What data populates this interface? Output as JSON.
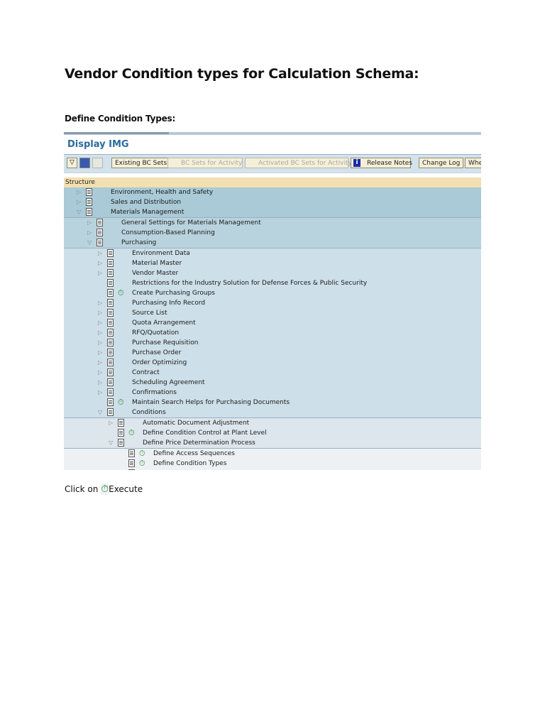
{
  "heading": "Vendor Condition types for Calculation Schema:",
  "subheading": "Define Condition Types:",
  "screen": {
    "title": "Display IMG",
    "toolbar": {
      "existing_bc_sets": "Existing BC Sets",
      "bc_sets_for_activity": "BC Sets for Activity",
      "activated_bc_sets": "Activated BC Sets for Activity",
      "release_notes": "Release Notes",
      "change_log": "Change Log",
      "where_used": "Whe"
    },
    "structure_header": "Structure",
    "colors": {
      "level0": "#a9cad6",
      "level1": "#b9d3de",
      "level2": "#cddfe8",
      "level3": "#dde6ec",
      "level4": "#eef1f3"
    },
    "rows": [
      {
        "label": "Environment, Health and Safety",
        "level": 0,
        "expander": "collapsed",
        "execute": false
      },
      {
        "label": "Sales and Distribution",
        "level": 0,
        "expander": "collapsed",
        "execute": false
      },
      {
        "label": "Materials Management",
        "level": 0,
        "expander": "expanded",
        "execute": false
      },
      {
        "label": "General Settings for Materials Management",
        "level": 1,
        "expander": "collapsed",
        "execute": false
      },
      {
        "label": "Consumption-Based Planning",
        "level": 1,
        "expander": "collapsed",
        "execute": false
      },
      {
        "label": "Purchasing",
        "level": 1,
        "expander": "expanded",
        "execute": false
      },
      {
        "label": "Environment Data",
        "level": 2,
        "expander": "collapsed",
        "execute": false
      },
      {
        "label": "Material Master",
        "level": 2,
        "expander": "collapsed",
        "execute": false
      },
      {
        "label": "Vendor Master",
        "level": 2,
        "expander": "collapsed",
        "execute": false
      },
      {
        "label": "Restrictions for the Industry Solution for Defense Forces & Public Security",
        "level": 2,
        "expander": "none",
        "execute": false
      },
      {
        "label": "Create Purchasing Groups",
        "level": 2,
        "expander": "none",
        "execute": true
      },
      {
        "label": "Purchasing Info Record",
        "level": 2,
        "expander": "collapsed",
        "execute": false
      },
      {
        "label": "Source List",
        "level": 2,
        "expander": "collapsed",
        "execute": false
      },
      {
        "label": "Quota Arrangement",
        "level": 2,
        "expander": "collapsed",
        "execute": false
      },
      {
        "label": "RFQ/Quotation",
        "level": 2,
        "expander": "collapsed",
        "execute": false
      },
      {
        "label": "Purchase Requisition",
        "level": 2,
        "expander": "collapsed",
        "execute": false
      },
      {
        "label": "Purchase Order",
        "level": 2,
        "expander": "collapsed",
        "execute": false
      },
      {
        "label": "Order Optimizing",
        "level": 2,
        "expander": "collapsed",
        "execute": false
      },
      {
        "label": "Contract",
        "level": 2,
        "expander": "collapsed",
        "execute": false
      },
      {
        "label": "Scheduling Agreement",
        "level": 2,
        "expander": "collapsed",
        "execute": false
      },
      {
        "label": "Confirmations",
        "level": 2,
        "expander": "collapsed",
        "execute": false
      },
      {
        "label": "Maintain Search Helps for Purchasing Documents",
        "level": 2,
        "expander": "none",
        "execute": true
      },
      {
        "label": "Conditions",
        "level": 2,
        "expander": "expanded",
        "execute": false
      },
      {
        "label": "Automatic Document Adjustment",
        "level": 3,
        "expander": "collapsed",
        "execute": false
      },
      {
        "label": "Define Condition Control at Plant Level",
        "level": 3,
        "expander": "none",
        "execute": true
      },
      {
        "label": "Define Price Determination Process",
        "level": 3,
        "expander": "expanded",
        "execute": false
      },
      {
        "label": "Define Access Sequences",
        "level": 4,
        "expander": "none",
        "execute": true
      },
      {
        "label": "Define Condition Types",
        "level": 4,
        "expander": "none",
        "execute": true
      },
      {
        "label": "",
        "level": 4,
        "expander": "none",
        "execute": true
      }
    ]
  },
  "footer": {
    "prefix": "Click on",
    "action": "Execute"
  }
}
